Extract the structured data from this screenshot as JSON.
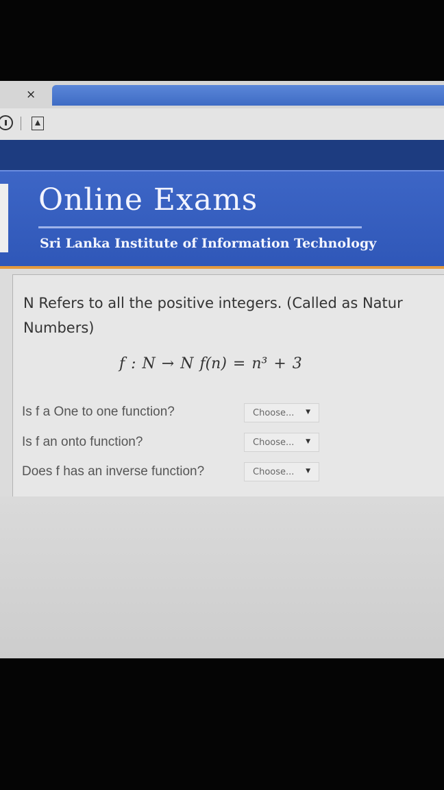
{
  "browser": {
    "close_glyph": "×",
    "info_icon": "info-circle-icon",
    "page_icon": "page-icon"
  },
  "header": {
    "title": "Online Exams",
    "subtitle": "Sri Lanka Institute of Information Technology"
  },
  "question": {
    "text_line1": "N Refers to all the positive integers. (Called as Natur",
    "text_line2": "Numbers)",
    "formula": "f : N → N  f(n) = n³ + 3"
  },
  "rows": [
    {
      "label": "Is f a One to one function?",
      "select_value": "Choose...",
      "arrow": "▼"
    },
    {
      "label": "Is f an onto function?",
      "select_value": "Choose...",
      "arrow": "▼"
    },
    {
      "label": "Does f has an inverse function?",
      "select_value": "Choose...",
      "arrow": "▼"
    }
  ],
  "colors": {
    "header_blue": "#2f57b8",
    "accent_orange": "#e49a3e",
    "tab_blue": "#4f7ad0"
  }
}
